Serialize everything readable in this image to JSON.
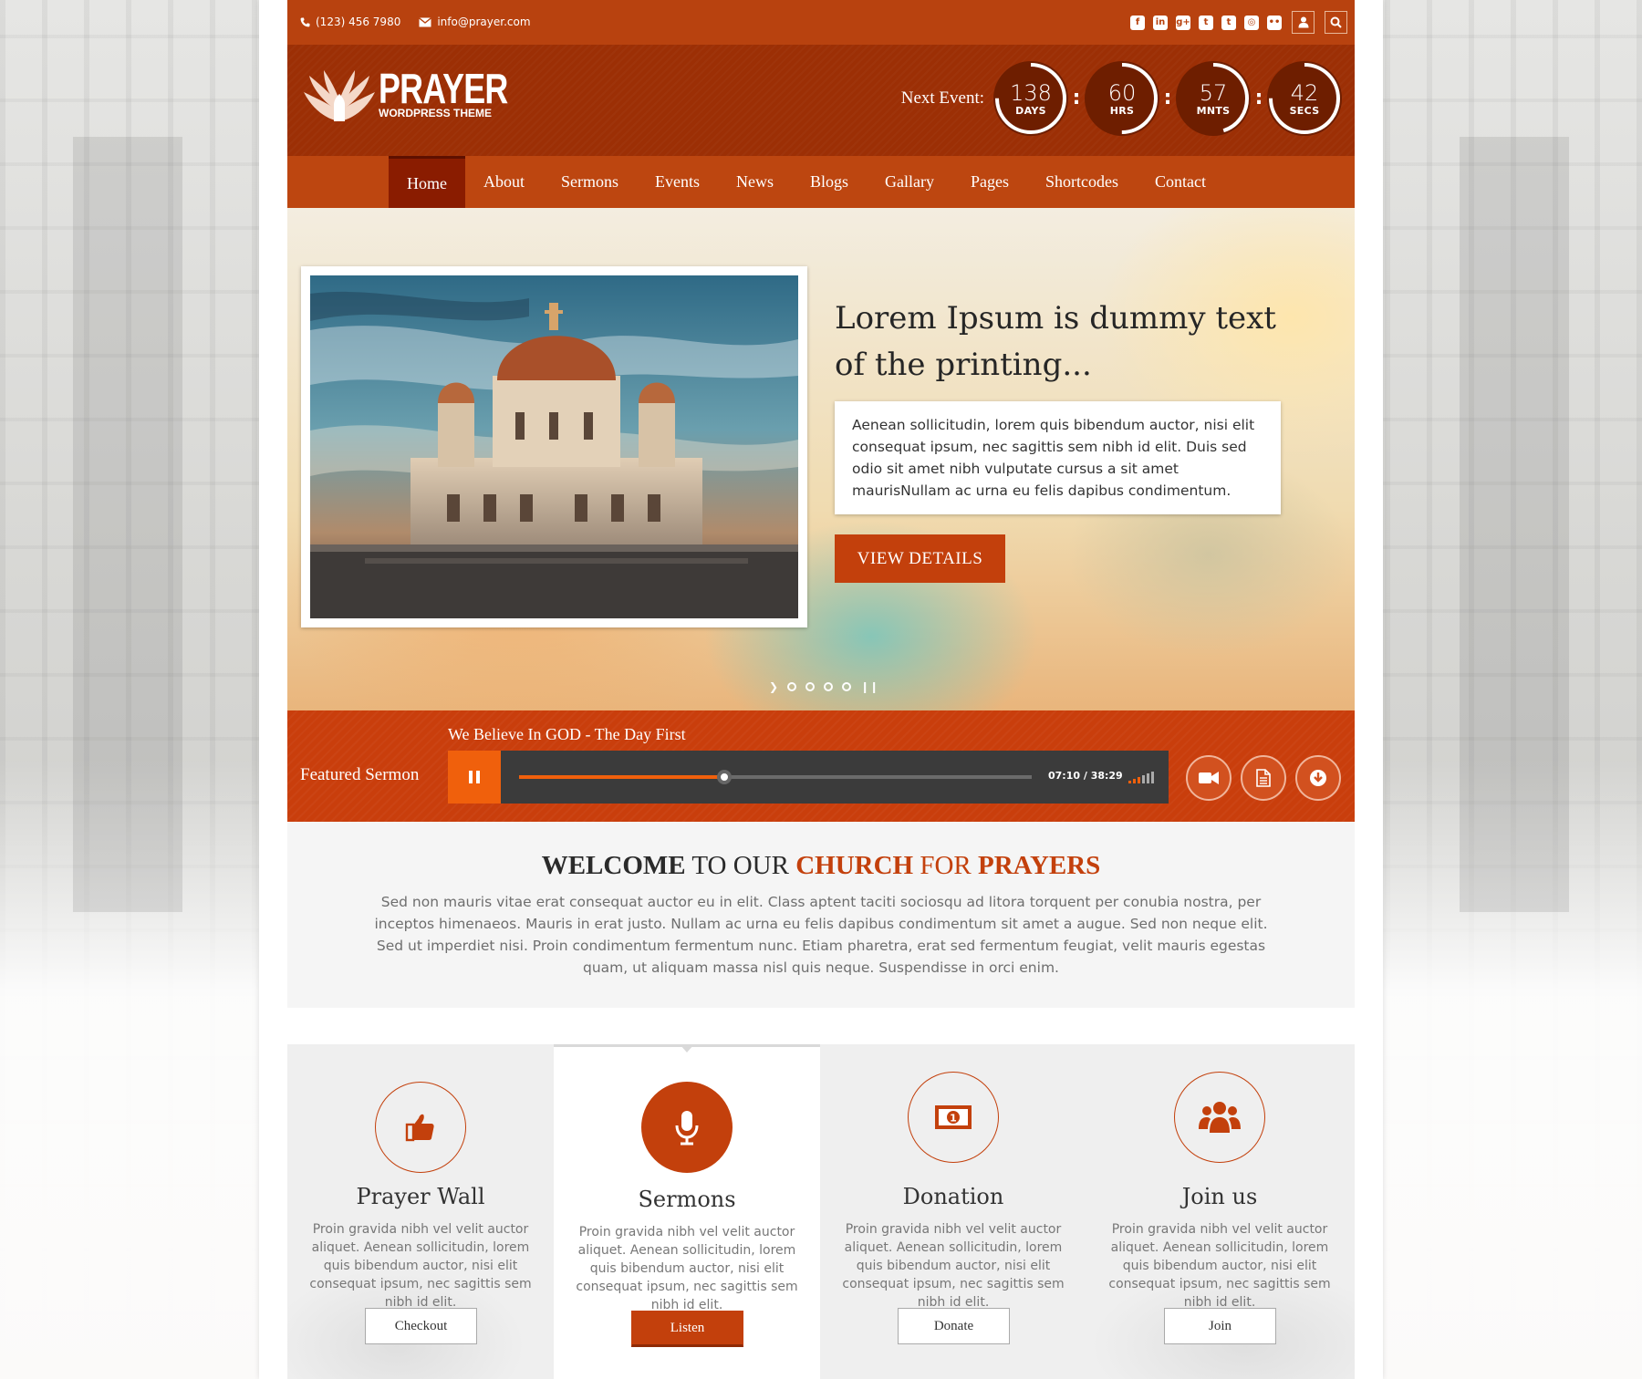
{
  "colors": {
    "accent": "#c3400c",
    "topbar": "#b8420f",
    "header": "#9c2f05",
    "nav": "#bd4610",
    "nav_active": "#8a1c00",
    "sermon_bar": "#c93e0c",
    "player_bg": "#3b3b3b",
    "player_orange": "#f0600c"
  },
  "topbar": {
    "phone": "(123) 456 7980",
    "email": "info@prayer.com",
    "phone_icon": "phone-icon",
    "email_icon": "envelope-icon",
    "social_icons": [
      "facebook-icon",
      "linkedin-icon",
      "google-plus-icon",
      "twitter-icon",
      "tumblr-icon",
      "instagram-icon",
      "flickr-icon"
    ],
    "user_icon": "user-icon",
    "search_icon": "search-icon"
  },
  "header": {
    "logo_title": "PRAYER",
    "logo_subtitle": "WORDPRESS THEME",
    "event_label": "Next Event:",
    "countdown": [
      {
        "value": "138",
        "unit": "DAYS",
        "progress": 0.75
      },
      {
        "value": "60",
        "unit": "HRS",
        "progress": 0.5
      },
      {
        "value": "57",
        "unit": "MNTS",
        "progress": 0.45
      },
      {
        "value": "42",
        "unit": "SECS",
        "progress": 0.75
      }
    ]
  },
  "nav": {
    "items": [
      "Home",
      "About",
      "Sermons",
      "Events",
      "News",
      "Blogs",
      "Gallary",
      "Pages",
      "Shortcodes",
      "Contact"
    ],
    "active": "Home"
  },
  "hero": {
    "title": "Lorem Ipsum is dummy text of the printing...",
    "body": "Aenean sollicitudin, lorem quis bibendum auctor, nisi elit consequat ipsum, nec sagittis sem nibh id elit. Duis sed odio sit amet nibh vulputate cursus a sit amet maurisNullam ac urna eu felis dapibus condimentum.",
    "button": "VIEW DETAILS",
    "slide_count": 4
  },
  "sermon": {
    "label": "Featured Sermon",
    "title": "We Believe In GOD -  The Day First",
    "time": "07:10 / 38:29",
    "progress": 0.4,
    "play_icon": "pause-icon",
    "volume_icon": "volume-bars-icon",
    "actions": [
      "video-camera-icon",
      "document-icon",
      "download-icon"
    ]
  },
  "welcome": {
    "w1": "WELCOME",
    "w2": " TO OUR ",
    "w3": "CHURCH",
    "w4": " FOR ",
    "w5": "PRAYERS",
    "body": "Sed non  mauris vitae erat consequat auctor eu in elit. Class aptent taciti sociosqu ad litora torquent per conubia nostra, per inceptos himenaeos. Mauris in erat justo. Nullam ac urna eu felis dapibus condimentum sit amet a augue. Sed non neque elit. Sed ut imperdiet nisi. Proin condimentum fermentum nunc. Etiam pharetra, erat sed fermentum feugiat, velit mauris egestas quam, ut aliquam massa nisl quis neque. Suspendisse in orci enim."
  },
  "features": [
    {
      "title": "Prayer Wall",
      "icon": "thumbs-up-icon",
      "text": "Proin gravida nibh vel velit auctor aliquet. Aenean sollicitudin, lorem quis bibendum auctor, nisi elit consequat ipsum, nec sagittis sem nibh id elit.",
      "button": "Checkout"
    },
    {
      "title": "Sermons",
      "icon": "microphone-icon",
      "text": "Proin gravida nibh vel velit auctor aliquet. Aenean sollicitudin, lorem quis bibendum auctor, nisi elit consequat ipsum, nec sagittis sem nibh id elit.",
      "button": "Listen"
    },
    {
      "title": "Donation",
      "icon": "money-bill-icon",
      "text": "Proin gravida nibh vel velit auctor aliquet. Aenean sollicitudin, lorem quis bibendum auctor, nisi elit consequat ipsum, nec sagittis sem nibh id elit.",
      "button": "Donate"
    },
    {
      "title": "Join us",
      "icon": "users-group-icon",
      "text": "Proin gravida nibh vel velit auctor aliquet. Aenean sollicitudin, lorem quis bibendum auctor, nisi elit consequat ipsum, nec sagittis sem nibh id elit.",
      "button": "Join"
    }
  ]
}
